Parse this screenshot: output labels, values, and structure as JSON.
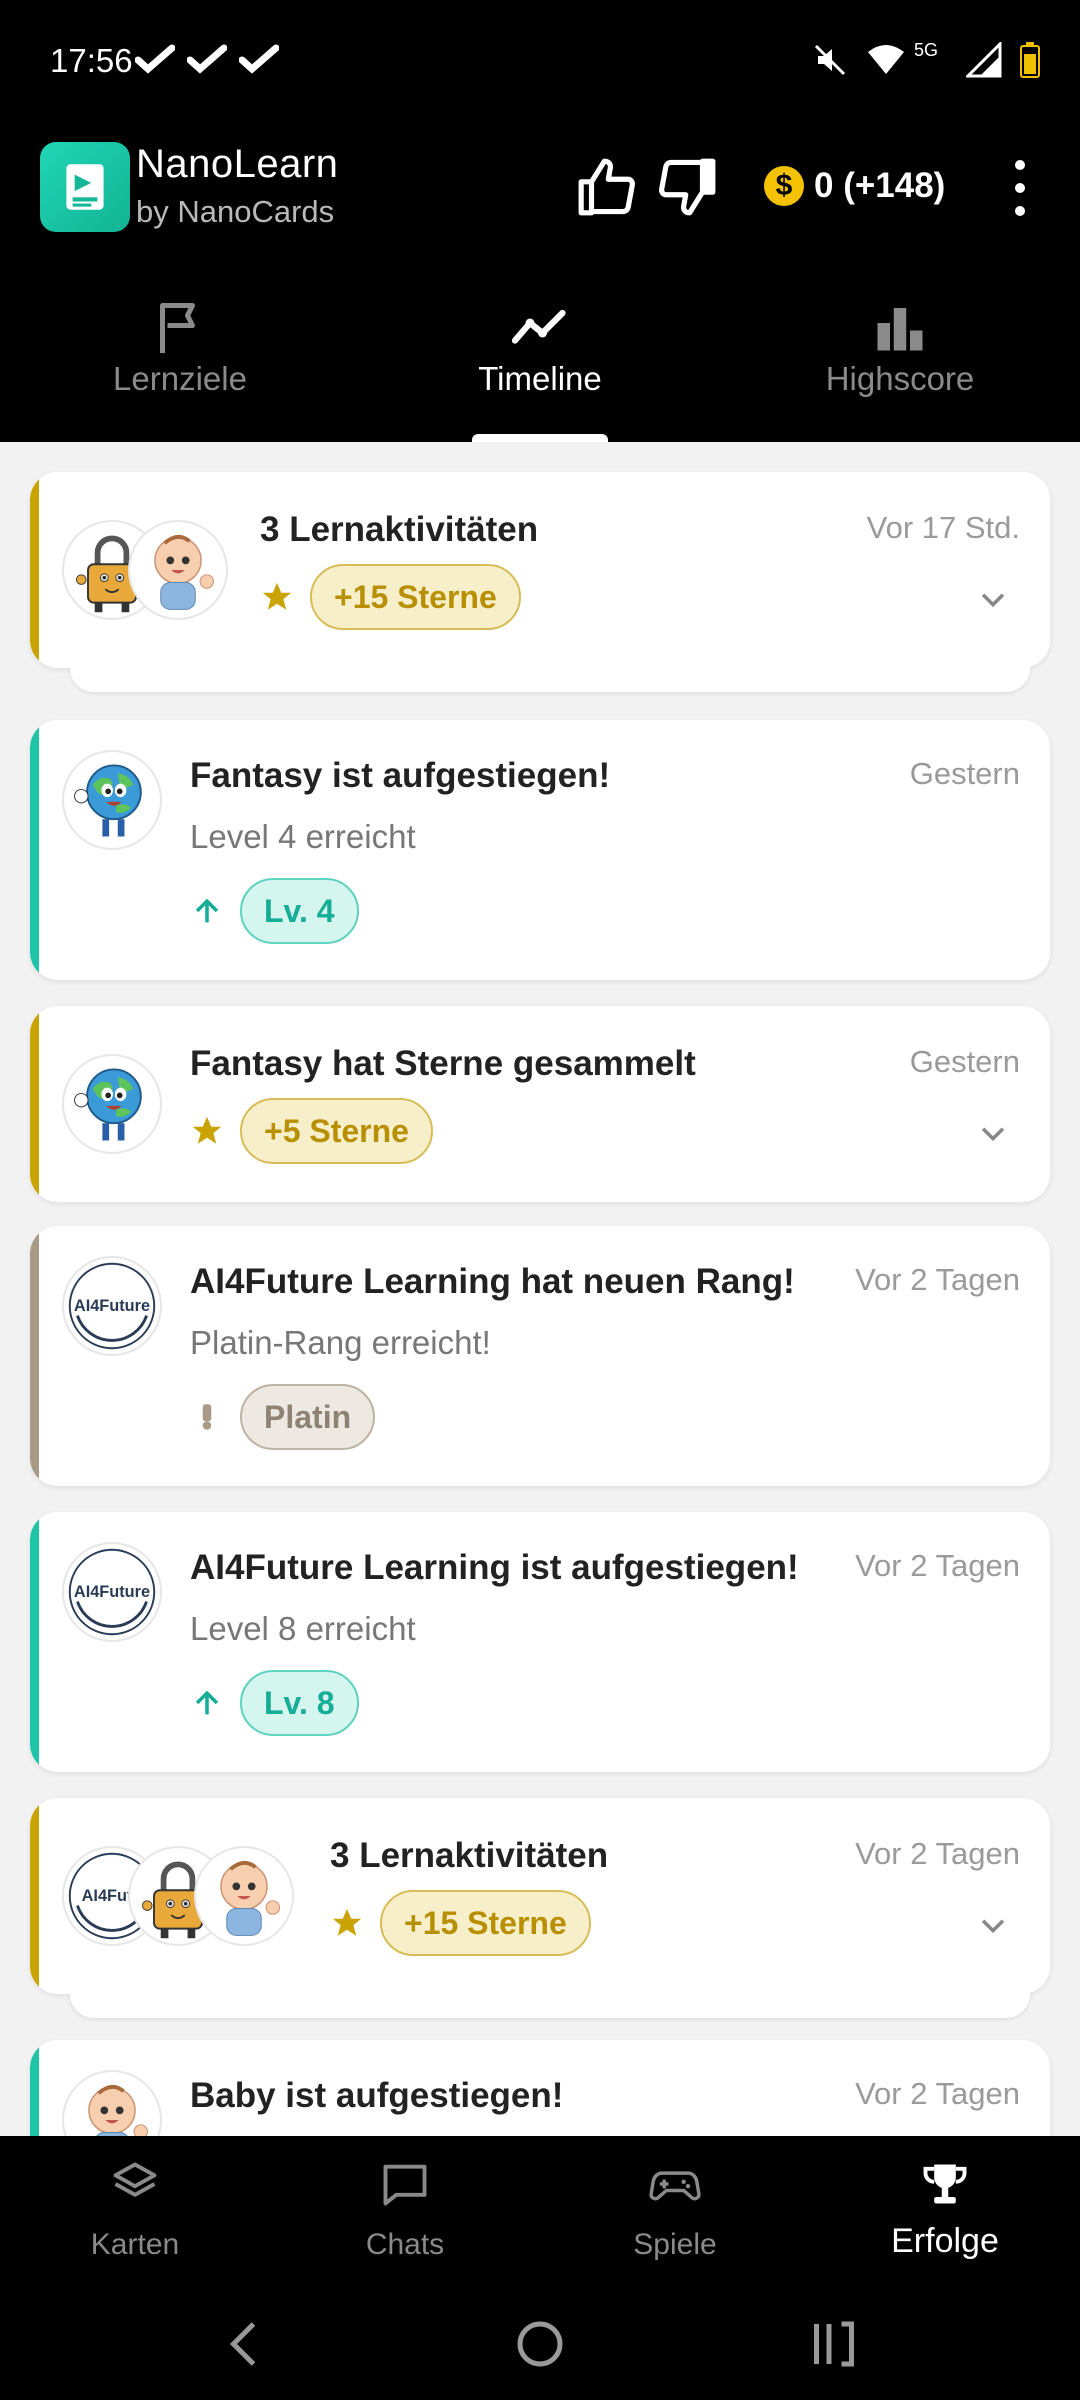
{
  "status_bar": {
    "time": "17:56",
    "network": "5G"
  },
  "app": {
    "title": "NanoLearn",
    "subtitle": "by NanoCards",
    "coins": "0 (+148)",
    "coin_symbol": "$"
  },
  "top_tabs": [
    {
      "label": "Lernziele",
      "icon": "flag-icon",
      "active": false
    },
    {
      "label": "Timeline",
      "icon": "trend-icon",
      "active": true
    },
    {
      "label": "Highscore",
      "icon": "bar-chart-icon",
      "active": false
    }
  ],
  "cards": [
    {
      "title": "3 Lernaktivitäten",
      "time": "Vor 17 Std.",
      "chip": "+15 Sterne",
      "accent": "#c9a400",
      "avatars": [
        "lock-mascot",
        "baby-mascot"
      ]
    },
    {
      "title": "Fantasy ist aufgestiegen!",
      "subtitle": "Level 4 erreicht",
      "time": "Gestern",
      "chip": "Lv. 4",
      "accent": "#1ec4a8",
      "avatars": [
        "globe-mascot"
      ]
    },
    {
      "title": "Fantasy hat Sterne gesammelt",
      "time": "Gestern",
      "chip": "+5 Sterne",
      "accent": "#c9a400",
      "avatars": [
        "globe-mascot"
      ]
    },
    {
      "title": "AI4Future Learning hat neuen Rang!",
      "subtitle": "Platin-Rang erreicht!",
      "time": "Vor 2 Tagen",
      "chip": "Platin",
      "accent": "#a89a86",
      "avatars": [
        "ai4future-logo"
      ]
    },
    {
      "title": "AI4Future Learning ist aufgestiegen!",
      "subtitle": "Level 8 erreicht",
      "time": "Vor 2 Tagen",
      "chip": "Lv. 8",
      "accent": "#1ec4a8",
      "avatars": [
        "ai4future-logo"
      ]
    },
    {
      "title": "3 Lernaktivitäten",
      "time": "Vor 2 Tagen",
      "chip": "+15 Sterne",
      "accent": "#c9a400",
      "avatars": [
        "ai4future-logo",
        "lock-mascot",
        "baby-mascot"
      ]
    },
    {
      "title": "Baby ist aufgestiegen!",
      "time": "Vor 2 Tagen",
      "accent": "#1ec4a8",
      "avatars": [
        "baby-mascot"
      ]
    }
  ],
  "ai4future_logo_text": "AI4Future",
  "ai4future_logo_text_cropped": "AI4Futu",
  "bottom_nav": [
    {
      "label": "Karten",
      "icon": "layers-icon",
      "active": false
    },
    {
      "label": "Chats",
      "icon": "chat-icon",
      "active": false
    },
    {
      "label": "Spiele",
      "icon": "gamepad-icon",
      "active": false
    },
    {
      "label": "Erfolge",
      "icon": "trophy-icon",
      "active": true
    }
  ]
}
